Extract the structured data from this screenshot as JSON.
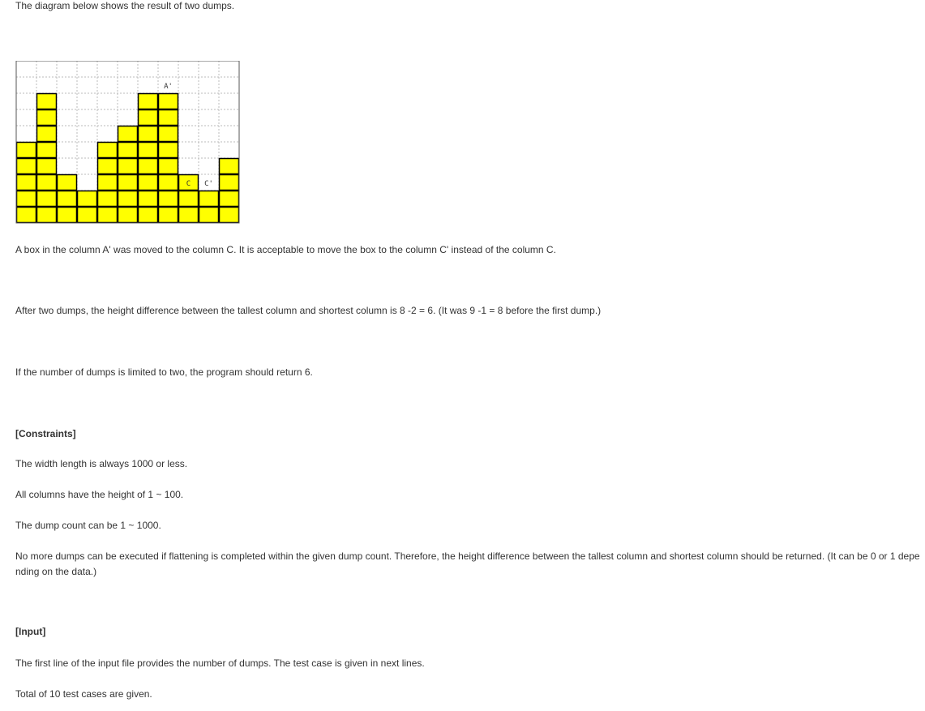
{
  "text": {
    "intro": "The diagram below shows the result of two dumps.",
    "moved": "A box in the column A' was moved to the column C. It is acceptable to move the box to the column C' instead of the column C.",
    "after": "After two dumps, the height difference between the tallest column and shortest column is 8 -2 = 6. (It was 9 -1 = 8 before the first dump.)",
    "limited": "If the number of dumps is limited to two, the program should return 6.",
    "constraints_heading": "[Constraints]",
    "c1": "The width length is always 1000 or less.",
    "c2": "All columns have the height of 1 ~ 100.",
    "c3": "The dump count can be 1 ~ 1000.",
    "c4": "No more dumps can be executed if flattening is completed within the given dump count. Therefore, the height difference between the tallest column and shortest column should be returned. (It can be 0 or 1 depe nding on the data.)",
    "input_heading": "[Input]",
    "i1": "The first line of the input file provides the number of dumps. The test case is given in next lines.",
    "i2": "Total of 10 test cases are given."
  },
  "diagram": {
    "heights": [
      5,
      8,
      3,
      2,
      5,
      6,
      8,
      8,
      3,
      2,
      4
    ],
    "grid_rows": 10,
    "labels": [
      {
        "text": "A'",
        "col": 7,
        "row": 9
      },
      {
        "text": "C",
        "col": 8,
        "row": 3
      },
      {
        "text": "C'",
        "col": 9,
        "row": 3
      }
    ],
    "fill_color": "#ffff00",
    "line_color": "#000000",
    "grid_color": "#bbbbbb"
  }
}
